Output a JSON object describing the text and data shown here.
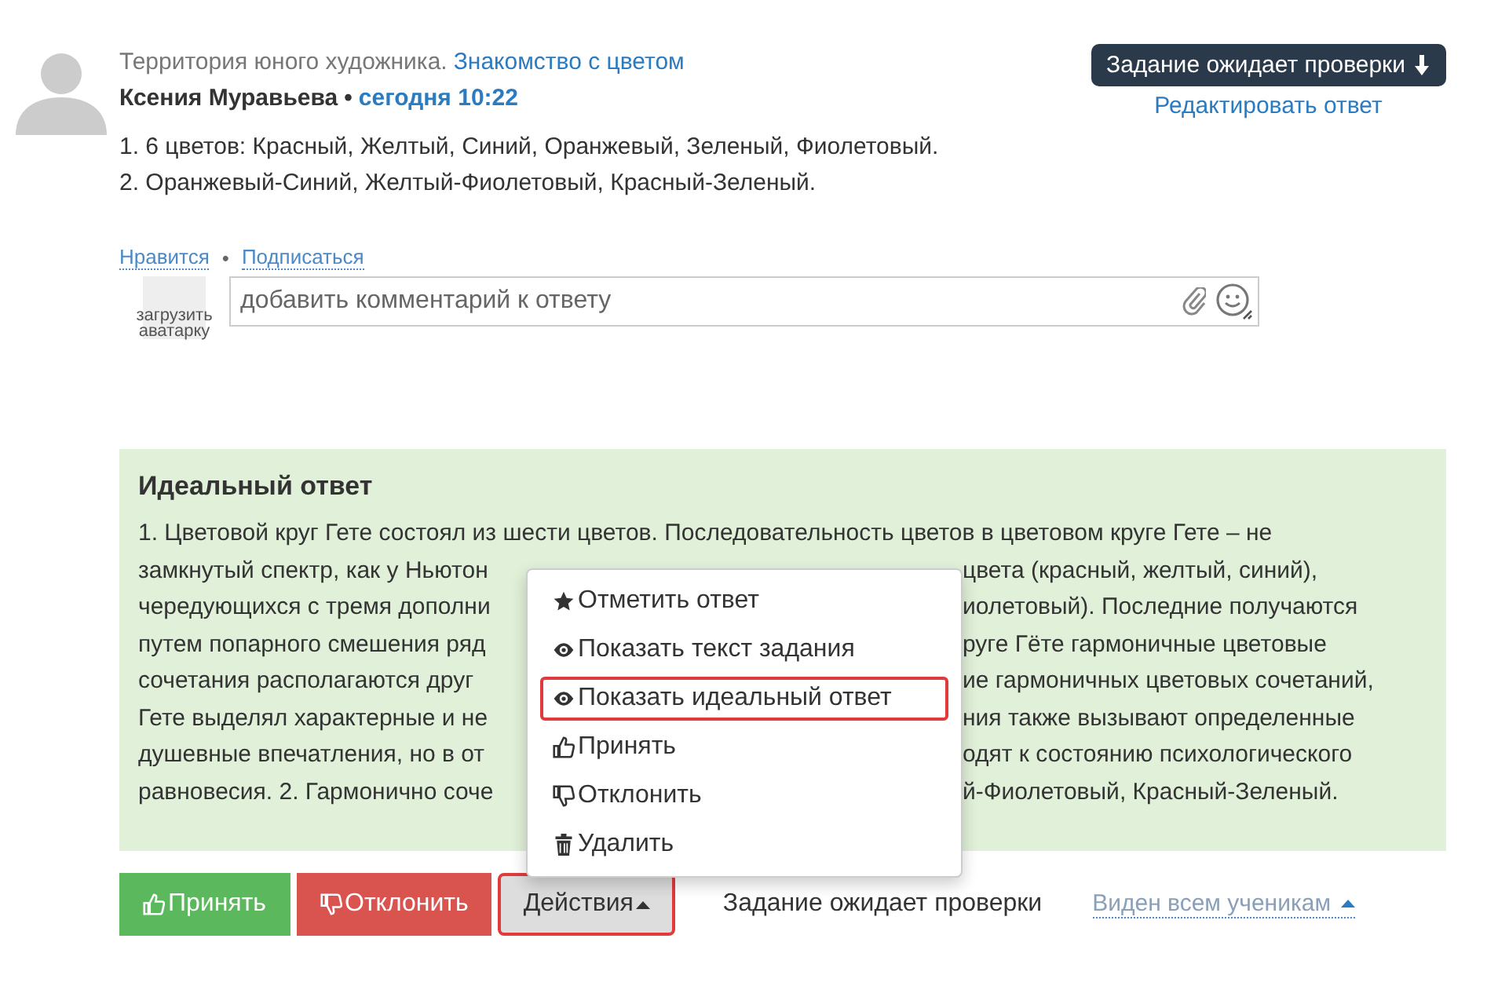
{
  "post": {
    "course": "Территория юного художника.",
    "lesson": "Знакомство с цветом",
    "author": "Ксения Муравьева",
    "separator": "•",
    "time": "сегодня 10:22",
    "answer": [
      "1. 6 цветов: Красный, Желтый, Синий, Оранжевый, Зеленый, Фиолетовый.",
      "2. Оранжевый-Синий, Желтый-Фиолетовый, Красный-Зеленый."
    ]
  },
  "status_button": {
    "label": "Задание ожидает проверки"
  },
  "edit_link": "Редактировать ответ",
  "social": {
    "like": "Нравится",
    "separator": "•",
    "subscribe": "Подписаться"
  },
  "comment": {
    "avatar_label": "загрузить аватарку",
    "placeholder": "добавить комментарий к ответу"
  },
  "ideal_answer": {
    "title": "Идеальный ответ",
    "lines": [
      {
        "left": "1. Цветовой круг Гете состоял из шести цветов. Последовательность цветов в цветовом круге Гете – не"
      },
      {
        "left": "замкнутый спектр, как у Ньютон",
        "right": "цвета (красный, желтый, синий),"
      },
      {
        "left": "чередующихся с тремя дополни",
        "right": "иолетовый). Последние получаются"
      },
      {
        "left": "путем попарного смешения ряд",
        "right": "руге Гёте гармоничные цветовые"
      },
      {
        "left": "сочетания располагаются друг",
        "right": "ие гармоничных цветовых сочетаний,"
      },
      {
        "left": "Гете выделял характерные и не",
        "right": "ния также вызывают определенные"
      },
      {
        "left": "душевные впечатления, но в от",
        "right": "одят к состоянию психологического"
      },
      {
        "left": "равновесия. 2. Гармонично соче",
        "right": "й-Фиолетовый, Красный-Зеленый."
      }
    ]
  },
  "menu": [
    {
      "kind": "star",
      "label": "Отметить ответ",
      "highlighted": false
    },
    {
      "kind": "eye",
      "label": "Показать текст задания",
      "highlighted": false
    },
    {
      "kind": "eye",
      "label": "Показать идеальный ответ",
      "highlighted": true
    },
    {
      "kind": "like",
      "label": "Принять",
      "highlighted": false
    },
    {
      "kind": "dislike",
      "label": "Отклонить",
      "highlighted": false
    },
    {
      "kind": "trash",
      "label": "Удалить",
      "highlighted": false
    }
  ],
  "actions": [
    {
      "kind": "accept",
      "label": "Принять"
    },
    {
      "kind": "reject",
      "label": "Отклонить"
    },
    {
      "kind": "menu",
      "label": "Действия",
      "highlighted": true,
      "expanded": true
    }
  ],
  "status_text": "Задание ожидает проверки",
  "visibility": {
    "label": "Виден всем ученикам",
    "expanded": true
  }
}
